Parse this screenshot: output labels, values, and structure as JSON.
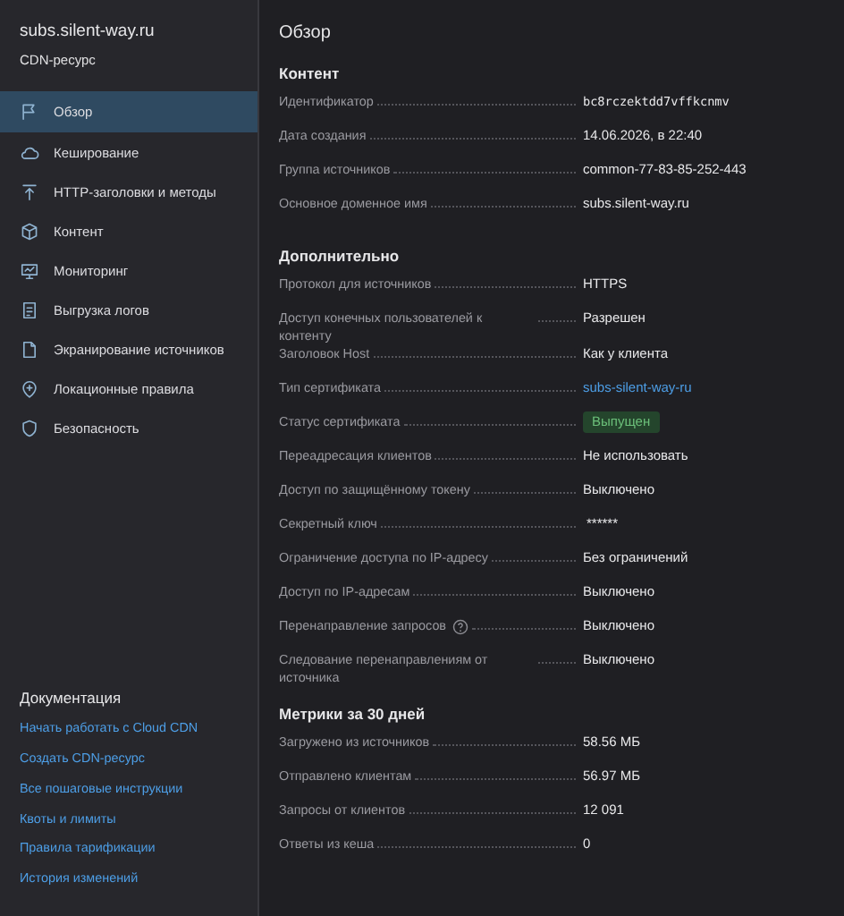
{
  "sidebar": {
    "title": "subs.silent-way.ru",
    "subtitle": "CDN-ресурс",
    "items": [
      {
        "label": "Обзор",
        "selected": true
      },
      {
        "label": "Кеширование",
        "selected": false
      },
      {
        "label": "HTTP-заголовки и методы",
        "selected": false
      },
      {
        "label": "Контент",
        "selected": false
      },
      {
        "label": "Мониторинг",
        "selected": false
      },
      {
        "label": "Выгрузка логов",
        "selected": false
      },
      {
        "label": "Экранирование источников",
        "selected": false
      },
      {
        "label": "Локационные правила",
        "selected": false
      },
      {
        "label": "Безопасность",
        "selected": false
      }
    ],
    "docs": {
      "title": "Документация",
      "links": [
        "Начать работать с Cloud CDN",
        "Создать CDN-ресурс",
        "Все пошаговые инструкции",
        "Квоты и лимиты",
        "Правила тарификации",
        "История изменений"
      ]
    }
  },
  "main": {
    "title": "Обзор",
    "sections": [
      {
        "title": "Контент",
        "rows": [
          {
            "label": "Идентификатор",
            "value": "bc8rczektdd7vffkcnmv",
            "kind": "mono"
          },
          {
            "label": "Дата создания",
            "value": "14.06.2026, в 22:40",
            "kind": "text"
          },
          {
            "label": "Группа источников",
            "value": "common-77-83-85-252-443",
            "kind": "text"
          },
          {
            "label": "Основное доменное имя",
            "value": "subs.silent-way.ru",
            "kind": "text"
          }
        ]
      },
      {
        "title": "Дополнительно",
        "rows": [
          {
            "label": "Протокол для источников",
            "value": "HTTPS",
            "kind": "text"
          },
          {
            "label": "Доступ конечных пользователей к контенту",
            "value": "Разрешен",
            "kind": "text"
          },
          {
            "label": "Заголовок Host",
            "value": "Как у клиента",
            "kind": "text"
          },
          {
            "label": "Тип сертификата",
            "value": "subs-silent-way-ru",
            "kind": "link"
          },
          {
            "label": "Статус сертификата",
            "value": "Выпущен",
            "kind": "badge"
          },
          {
            "label": "Переадресация клиентов",
            "value": "Не использовать",
            "kind": "text"
          },
          {
            "label": "Доступ по защищённому токену",
            "value": "Выключено",
            "kind": "text"
          },
          {
            "label": "Секретный ключ",
            "value": "******",
            "kind": "secret"
          },
          {
            "label": "Ограничение доступа по IP-адресу",
            "value": "Без ограничений",
            "kind": "text"
          },
          {
            "label": "Доступ по IP-адресам",
            "value": "Выключено",
            "kind": "text"
          },
          {
            "label": "Перенаправление запросов",
            "value": "Выключено",
            "kind": "text",
            "help": true
          },
          {
            "label": "Следование перенаправлениям от источника",
            "value": "Выключено",
            "kind": "text"
          }
        ]
      },
      {
        "title": "Метрики за 30 дней",
        "rows": [
          {
            "label": "Загружено из источников",
            "value": "58.56 МБ",
            "kind": "text"
          },
          {
            "label": "Отправлено клиентам",
            "value": "56.97 МБ",
            "kind": "text"
          },
          {
            "label": "Запросы от клиентов",
            "value": "12 091",
            "kind": "text"
          },
          {
            "label": "Ответы из кеша",
            "value": "0",
            "kind": "text"
          }
        ]
      }
    ]
  }
}
